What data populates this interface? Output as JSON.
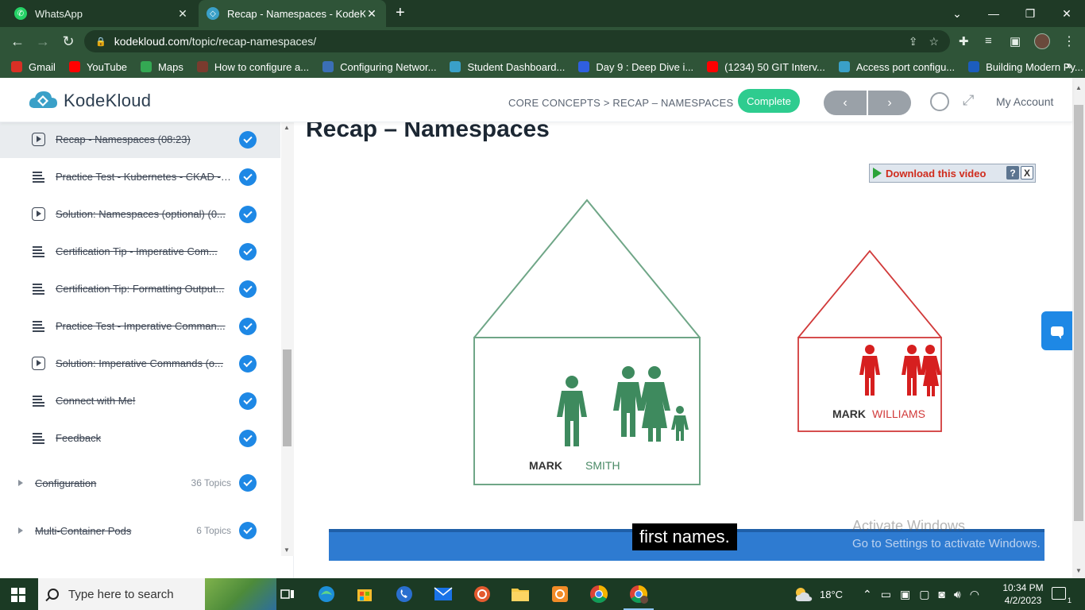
{
  "browser": {
    "tabs": [
      {
        "label": "WhatsApp",
        "icon": "whatsapp-icon",
        "active": false
      },
      {
        "label": "Recap - Namespaces - KodeKloud",
        "icon": "kodekloud-icon",
        "active": true
      }
    ],
    "url_host": "kodekloud.com",
    "url_path": "/topic/recap-namespaces/",
    "bookmarks": [
      {
        "label": "Gmail",
        "icon": "gmail-icon",
        "color": "#d93025"
      },
      {
        "label": "YouTube",
        "icon": "youtube-icon",
        "color": "#ff0000"
      },
      {
        "label": "Maps",
        "icon": "maps-icon",
        "color": "#34a853"
      },
      {
        "label": "How to configure a...",
        "icon": "page-icon",
        "color": "#7a3b2e"
      },
      {
        "label": "Configuring Networ...",
        "icon": "vmware-icon",
        "color": "#3b6fb6"
      },
      {
        "label": "Student Dashboard...",
        "icon": "kodekloud-icon",
        "color": "#3aa0c8"
      },
      {
        "label": "Day 9 : Deep Dive i...",
        "icon": "diamond-icon",
        "color": "#2f5fe0"
      },
      {
        "label": "(1234) 50 GIT Interv...",
        "icon": "youtube-icon",
        "color": "#ff0000"
      },
      {
        "label": "Access port configu...",
        "icon": "cisco-icon",
        "color": "#3aa0c8"
      },
      {
        "label": "Building Modern Py...",
        "icon": "c-icon",
        "color": "#1c5dbe"
      }
    ]
  },
  "header": {
    "brand": "KodeKloud",
    "breadcrumb": "CORE CONCEPTS > RECAP – NAMESPACES",
    "complete_label": "Complete",
    "prev_label": "‹",
    "next_label": "›",
    "account_label": "My Account"
  },
  "sidebar": {
    "lessons": [
      {
        "label": "Recap - Namespaces (08:23)",
        "type": "video",
        "current": true
      },
      {
        "label": "Practice Test - Kubernetes - CKAD - ...",
        "type": "text",
        "current": false
      },
      {
        "label": "Solution: Namespaces (optional) (0...",
        "type": "video",
        "current": false
      },
      {
        "label": "Certification Tip - Imperative Com...",
        "type": "text",
        "current": false
      },
      {
        "label": "Certification Tip: Formatting Output...",
        "type": "text",
        "current": false
      },
      {
        "label": "Practice Test - Imperative Comman...",
        "type": "text",
        "current": false
      },
      {
        "label": "Solution: Imperative Commands (o...",
        "type": "video",
        "current": false
      },
      {
        "label": "Connect with Me!",
        "type": "text",
        "current": false
      },
      {
        "label": "Feedback",
        "type": "text",
        "current": false
      }
    ],
    "modules": [
      {
        "label": "Configuration",
        "count": "36 Topics"
      },
      {
        "label": "Multi-Container Pods",
        "count": "6 Topics"
      }
    ]
  },
  "main": {
    "title": "Recap – Namespaces",
    "download_label": "Download this video",
    "download_help": "?",
    "download_close": "X",
    "house_left": {
      "first": "MARK",
      "last": "SMITH",
      "color": "#4a8a66"
    },
    "house_right": {
      "first": "MARK",
      "last": "WILLIAMS",
      "color": "#d13a3a"
    },
    "caption": "first names.",
    "watermark_title": "Activate Windows",
    "watermark_sub": "Go to Settings to activate Windows."
  },
  "taskbar": {
    "search_placeholder": "Type here to search",
    "temperature": "18°C",
    "time": "10:34 PM",
    "date": "4/2/2023",
    "notification_count": "1"
  }
}
